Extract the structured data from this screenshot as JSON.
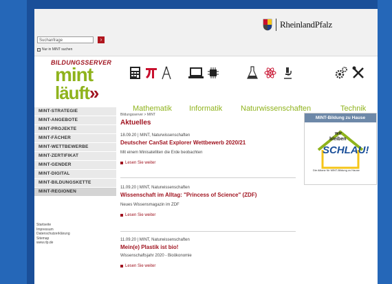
{
  "header": {
    "search_placeholder": "Suchanfrage",
    "search_button": "›",
    "mint_only_label": "Nur in MINT suchen",
    "state_name": "RheinlandPfalz"
  },
  "logo": {
    "line1": "BILDUNGSSERVER",
    "line2": "mint",
    "line3": "läuft",
    "line3_arrow": "»"
  },
  "subjects": [
    {
      "label": "Mathematik"
    },
    {
      "label": "Informatik"
    },
    {
      "label": "Naturwissenschaften"
    },
    {
      "label": "Technik"
    }
  ],
  "nav": {
    "items": [
      {
        "label": "MINT-STRATEGIE"
      },
      {
        "label": "MINT-ANGEBOTE"
      },
      {
        "label": "MINT-PROJEKTE"
      },
      {
        "label": "MINT-FÄCHER"
      },
      {
        "label": "MINT-WETTBEWERBE"
      },
      {
        "label": "MINT-ZERTIFIKAT"
      },
      {
        "label": "MINT-GENDER"
      },
      {
        "label": "MINT-DIGITAL"
      },
      {
        "label": "MINT-BILDUNGSKETTE"
      },
      {
        "label": "MINT-REGIONEN"
      }
    ],
    "footer": [
      "Startseite",
      "Impressum",
      "Datenschutzerklärung",
      "Sitemap",
      "www.rlp.de"
    ]
  },
  "main": {
    "breadcrumb": "Bildungsserver > MINT",
    "heading": "Aktuelles",
    "read_more": "Lesen Sie weiter",
    "articles": [
      {
        "meta": "18.09.20 | MINT, Naturwissenschaften",
        "title": "Deutscher CanSat Explorer Wettbewerb 2020/21",
        "teaser": "Mit einem Minisatelliten die Erde beobachten"
      },
      {
        "meta": "11.09.20 | MINT, Naturwissenschaften",
        "title": "Wissenschaft im Alltag: \"Princess of Science\" (ZDF)",
        "teaser": "Neues Wissensmagazin im ZDF"
      },
      {
        "meta": "11.09.20 | MINT, Naturwissenschaften",
        "title": "Mein(e) Plastik ist bio!",
        "teaser": "Wissenschaftsjahr 2020 - Bioökonomie"
      }
    ]
  },
  "side": {
    "heading": "MINT-Bildung zu Hause",
    "banner_line1": "wir",
    "banner_line2": "bleiben",
    "banner_line3": "SCHLAU!",
    "banner_caption": "Die Allianz für MINT-Bildung zu Hause"
  },
  "colors": {
    "brand_red": "#a01420",
    "mint_green": "#8fb31c",
    "side_header": "#6d88a8"
  }
}
